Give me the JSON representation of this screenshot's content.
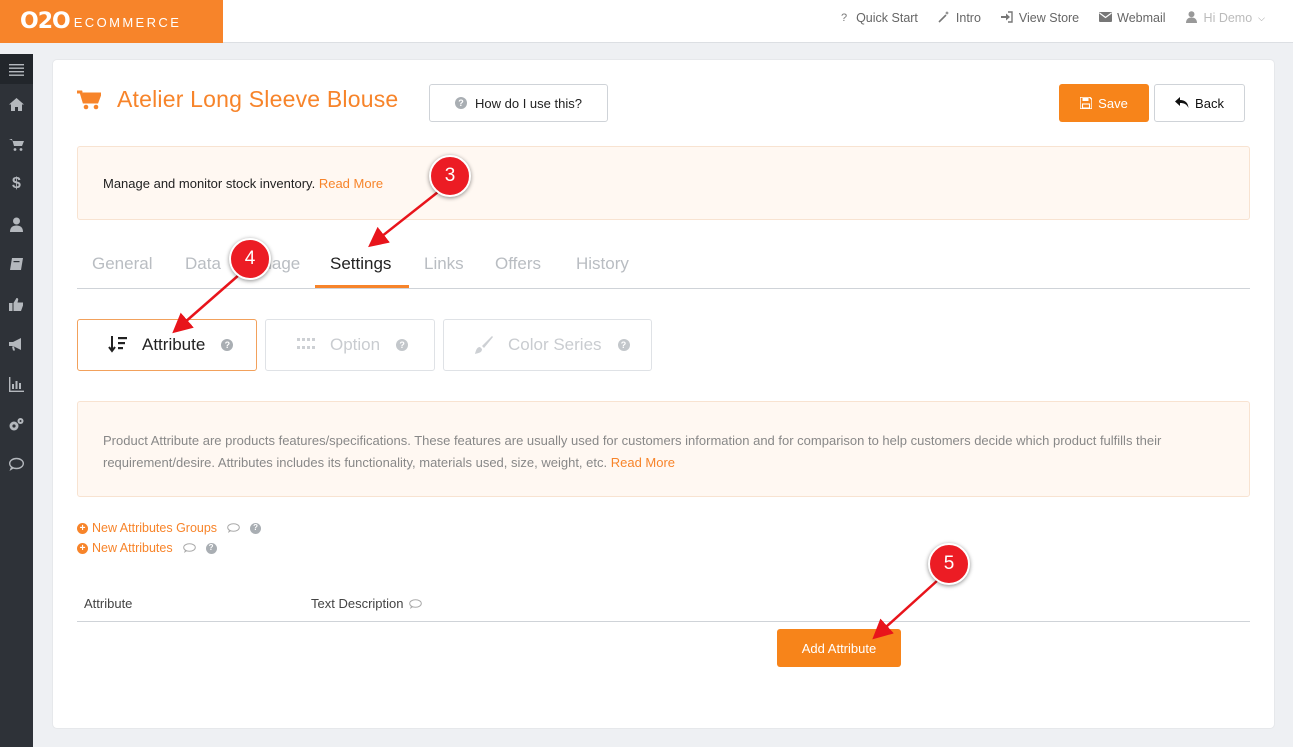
{
  "brand": {
    "mark": "O2O",
    "text": "ECOMMERCE",
    "color": "#f7842a"
  },
  "topnav": [
    {
      "label": "Quick Start",
      "icon": "question-icon"
    },
    {
      "label": "Intro",
      "icon": "magic-wand-icon"
    },
    {
      "label": "View Store",
      "icon": "sign-in-icon"
    },
    {
      "label": "Webmail",
      "icon": "envelope-icon"
    },
    {
      "label": "Hi Demo",
      "icon": "user-icon"
    }
  ],
  "sidebar": [
    "menu-icon",
    "home-icon",
    "cart-icon",
    "dollar-icon",
    "user-icon",
    "book-icon",
    "thumbs-up-icon",
    "bullhorn-icon",
    "bar-chart-icon",
    "cogs-icon",
    "comment-icon"
  ],
  "page": {
    "title": "Atelier Long Sleeve Blouse",
    "help_label": "How do I use this?",
    "save_label": "Save",
    "back_label": "Back"
  },
  "notice": {
    "text": "Manage and monitor stock inventory. ",
    "link": "Read More"
  },
  "tabs": [
    {
      "label": "General"
    },
    {
      "label": "Data"
    },
    {
      "label": "Image"
    },
    {
      "label": "Settings",
      "active": true
    },
    {
      "label": "Links"
    },
    {
      "label": "Offers"
    },
    {
      "label": "History"
    }
  ],
  "subtabs": [
    {
      "label": "Attribute",
      "active": true
    },
    {
      "label": "Option"
    },
    {
      "label": "Color Series"
    }
  ],
  "info": {
    "text": "Product Attribute are products features/specifications. These features are usually used for customers information and for comparison to help customers decide which product fulfills their requirement/desire. Attributes includes its functionality, materials used, size, weight, etc. ",
    "link": "Read More"
  },
  "links": {
    "groups": "New Attributes Groups",
    "attributes": "New Attributes"
  },
  "table": {
    "col1": "Attribute",
    "col2": "Text Description"
  },
  "add_button": "Add Attribute",
  "markers": [
    "3",
    "4",
    "5"
  ],
  "colors": {
    "accent": "#f7842a",
    "marker": "#ec1c24",
    "sidebar": "#2e3238"
  }
}
